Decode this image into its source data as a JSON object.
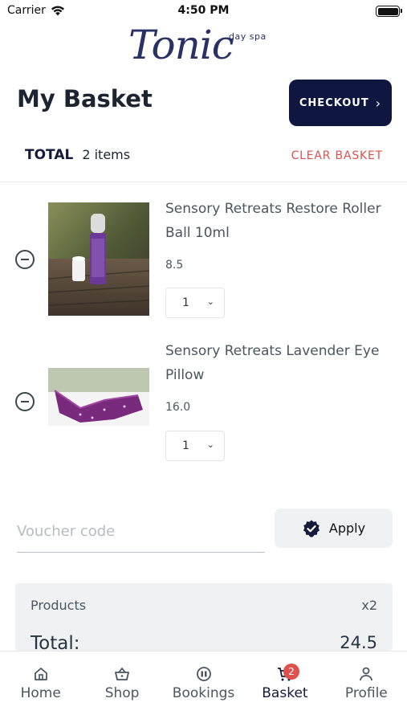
{
  "status_bar": {
    "carrier": "Carrier",
    "time": "4:50 PM"
  },
  "logo": {
    "wordmark": "Tonic",
    "subtitle": "day spa"
  },
  "header": {
    "title": "My Basket",
    "checkout_label": "CHECKOUT"
  },
  "totals_bar": {
    "total_label": "TOTAL",
    "item_count": "2 items",
    "clear_label": "CLEAR BASKET"
  },
  "basket_items": [
    {
      "name": "Sensory Retreats Restore Roller Ball 10ml",
      "price": "8.5",
      "quantity": "1"
    },
    {
      "name": "Sensory Retreats Lavender Eye Pillow",
      "price": "16.0",
      "quantity": "1"
    }
  ],
  "voucher": {
    "placeholder": "Voucher code",
    "apply_label": "Apply"
  },
  "summary": {
    "products_label": "Products",
    "products_count": "x2",
    "total_label": "Total:",
    "total_value": "24.5"
  },
  "tab_bar": {
    "tabs": [
      {
        "label": "Home",
        "icon": "home-icon"
      },
      {
        "label": "Shop",
        "icon": "basket-icon"
      },
      {
        "label": "Bookings",
        "icon": "calendar-icon"
      },
      {
        "label": "Basket",
        "icon": "cart-icon",
        "badge": "2",
        "active": true
      },
      {
        "label": "Profile",
        "icon": "user-icon"
      }
    ]
  },
  "colors": {
    "navy": "#0f1640",
    "danger": "#e0504d",
    "muted_bg": "#eff1f3",
    "text": "#4a5660"
  }
}
